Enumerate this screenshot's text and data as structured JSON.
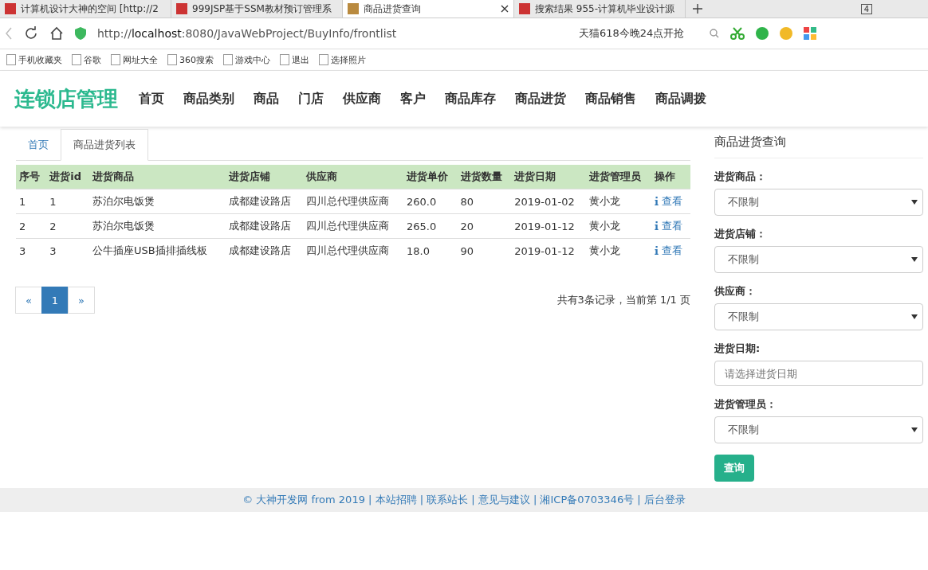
{
  "browser": {
    "tabs": [
      {
        "title": "计算机设计大神的空间 [http://2",
        "selected": false
      },
      {
        "title": "999JSP基于SSM教材预订管理系",
        "selected": false
      },
      {
        "title": "商品进货查询",
        "selected": true
      },
      {
        "title": "搜索结果 955-计算机毕业设计源",
        "selected": false
      }
    ],
    "tab_count": "4",
    "url": "http://**localhost**:8080/JavaWebProject/BuyInfo/frontlist",
    "search_hint": "天猫618今晚24点开抢",
    "bookmarks": [
      "手机收藏夹",
      "谷歌",
      "网址大全",
      "360搜索",
      "游戏中心",
      "退出",
      "选择照片"
    ]
  },
  "header": {
    "logo": "连锁店管理",
    "nav": [
      "首页",
      "商品类别",
      "商品",
      "门店",
      "供应商",
      "客户",
      "商品库存",
      "商品进货",
      "商品销售",
      "商品调拨"
    ]
  },
  "breadcrumb": [
    {
      "label": "首页",
      "selected": false
    },
    {
      "label": "商品进货列表",
      "selected": true
    }
  ],
  "table": {
    "columns": [
      "序号",
      "进货id",
      "进货商品",
      "进货店铺",
      "供应商",
      "进货单价",
      "进货数量",
      "进货日期",
      "进货管理员",
      "操作"
    ],
    "rows": [
      [
        "1",
        "1",
        "苏泊尔电饭煲",
        "成都建设路店",
        "四川总代理供应商",
        "260.0",
        "80",
        "2019-01-02",
        "黄小龙",
        "查看"
      ],
      [
        "2",
        "2",
        "苏泊尔电饭煲",
        "成都建设路店",
        "四川总代理供应商",
        "265.0",
        "20",
        "2019-01-12",
        "黄小龙",
        "查看"
      ],
      [
        "3",
        "3",
        "公牛插座USB插排插线板",
        "成都建设路店",
        "四川总代理供应商",
        "18.0",
        "90",
        "2019-01-12",
        "黄小龙",
        "查看"
      ]
    ]
  },
  "pagination": {
    "prev": "«",
    "pages": [
      {
        "label": "1",
        "selected": true
      }
    ],
    "next": "»",
    "summary": "共有3条记录，当前第 1/1 页"
  },
  "search_panel": {
    "title": "商品进货查询",
    "fields": [
      {
        "label": "进货商品：",
        "kind": "select",
        "value": "不限制"
      },
      {
        "label": "进货店铺：",
        "kind": "select",
        "value": "不限制"
      },
      {
        "label": "供应商：",
        "kind": "select",
        "value": "不限制"
      },
      {
        "label": "进货日期:",
        "kind": "text",
        "placeholder": "请选择进货日期"
      },
      {
        "label": "进货管理员：",
        "kind": "select",
        "value": "不限制"
      }
    ],
    "button": "查询"
  },
  "footer": "© 大神开发网 from 2019 | 本站招聘 | 联系站长 | 意见与建议 | 湘ICP备0703346号 | 后台登录"
}
